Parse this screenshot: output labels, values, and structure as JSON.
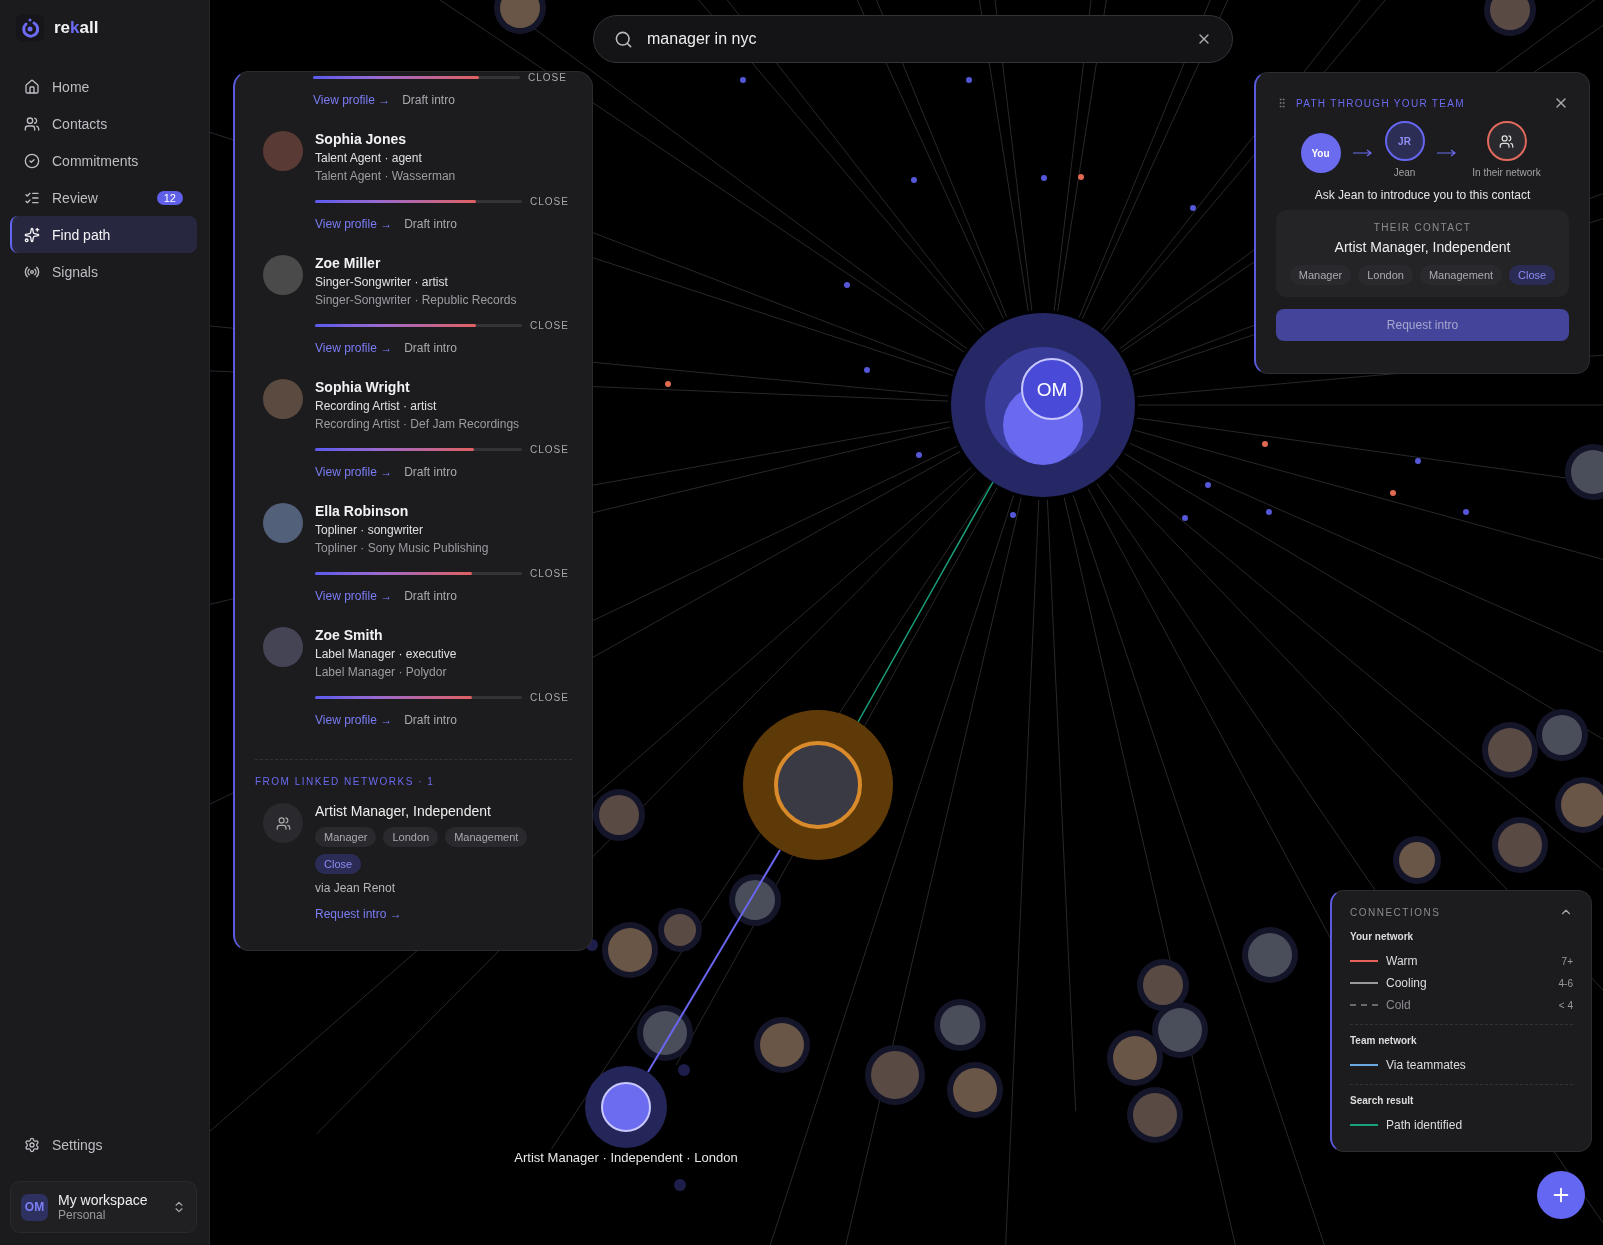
{
  "sidebar": {
    "brand": [
      {
        "text": "re",
        "accent": false
      },
      {
        "text": "k",
        "accent": true
      },
      {
        "text": "all",
        "accent": false
      }
    ],
    "items": [
      {
        "label": "Home",
        "selected": false
      },
      {
        "label": "Contacts",
        "selected": false
      },
      {
        "label": "Commitments",
        "selected": false
      },
      {
        "label": "Review",
        "selected": false,
        "badge": "12"
      },
      {
        "label": "Find path",
        "selected": true
      },
      {
        "label": "Signals",
        "selected": false
      }
    ],
    "settings": "Settings",
    "workspace": {
      "initials": "OM",
      "name": "My workspace",
      "subtitle": "Personal"
    }
  },
  "search": {
    "value": "manager in nyc"
  },
  "results": [
    {
      "kind": "partial",
      "level": 0.8,
      "strength": "CLOSE",
      "view": "View profile →",
      "draft": "Draft intro"
    },
    {
      "kind": "person",
      "name": "Sophia Jones",
      "role": "Talent Agent · agent",
      "company": "Talent Agent · Wasserman",
      "level": 0.78,
      "strength": "CLOSE",
      "view": "View profile →",
      "draft": "Draft intro"
    },
    {
      "kind": "person",
      "name": "Zoe Miller",
      "role": "Singer-Songwriter · artist",
      "company": "Singer-Songwriter · Republic Records",
      "level": 0.78,
      "strength": "CLOSE",
      "view": "View profile →",
      "draft": "Draft intro"
    },
    {
      "kind": "person",
      "name": "Sophia Wright",
      "role": "Recording Artist · artist",
      "company": "Recording Artist · Def Jam Recordings",
      "level": 0.77,
      "strength": "CLOSE",
      "view": "View profile →",
      "draft": "Draft intro"
    },
    {
      "kind": "person",
      "name": "Ella Robinson",
      "role": "Topliner · songwriter",
      "company": "Topliner · Sony Music Publishing",
      "level": 0.76,
      "strength": "CLOSE",
      "view": "View profile →",
      "draft": "Draft intro"
    },
    {
      "kind": "person",
      "name": "Zoe Smith",
      "role": "Label Manager · executive",
      "company": "Label Manager · Polydor",
      "level": 0.76,
      "strength": "CLOSE",
      "view": "View profile →",
      "draft": "Draft intro"
    }
  ],
  "linked": {
    "heading": "FROM LINKED NETWORKS · 1",
    "title": "Artist Manager, Independent",
    "tags": [
      {
        "label": "Manager",
        "highlight": false
      },
      {
        "label": "London",
        "highlight": false
      },
      {
        "label": "Management",
        "highlight": false
      },
      {
        "label": "Close",
        "highlight": true
      }
    ],
    "via": "via Jean Renot",
    "action": "Request intro →"
  },
  "path_panel": {
    "title": "PATH THROUGH YOUR TEAM",
    "steps": [
      {
        "kind": "self",
        "label": "You"
      },
      {
        "kind": "teammate",
        "label": "JR",
        "caption": "Jean"
      },
      {
        "kind": "network",
        "caption": "In their network"
      }
    ],
    "message": "Ask Jean to introduce you to this contact",
    "contact": {
      "heading": "THEIR CONTACT",
      "name": "Artist Manager, Independent",
      "tags": [
        {
          "label": "Manager",
          "highlight": false
        },
        {
          "label": "London",
          "highlight": false
        },
        {
          "label": "Management",
          "highlight": false
        },
        {
          "label": "Close",
          "highlight": true
        }
      ]
    },
    "button": "Request intro"
  },
  "graph": {
    "center_initials": "OM",
    "selected_label": "Artist Manager · Independent · London"
  },
  "connections": {
    "title": "CONNECTIONS",
    "expanded": true,
    "groups": [
      {
        "title": "Your network",
        "items": [
          {
            "label": "Warm",
            "value": "7+",
            "color": "#e8605a",
            "kind": "solid",
            "dim": false
          },
          {
            "label": "Cooling",
            "value": "4-6",
            "color": "#9a9a9a",
            "kind": "solid",
            "dim": false
          },
          {
            "label": "Cold",
            "value": "< 4",
            "color": "#6a6a6a",
            "kind": "dashed",
            "dim": true
          }
        ]
      },
      {
        "title": "Team network",
        "items": [
          {
            "label": "Via teammates",
            "color": "#6aa8e0",
            "kind": "solid",
            "dim": false
          }
        ]
      },
      {
        "title": "Search result",
        "items": [
          {
            "label": "Path identified",
            "color": "#18a07c",
            "kind": "solid",
            "dim": false
          }
        ]
      }
    ]
  }
}
